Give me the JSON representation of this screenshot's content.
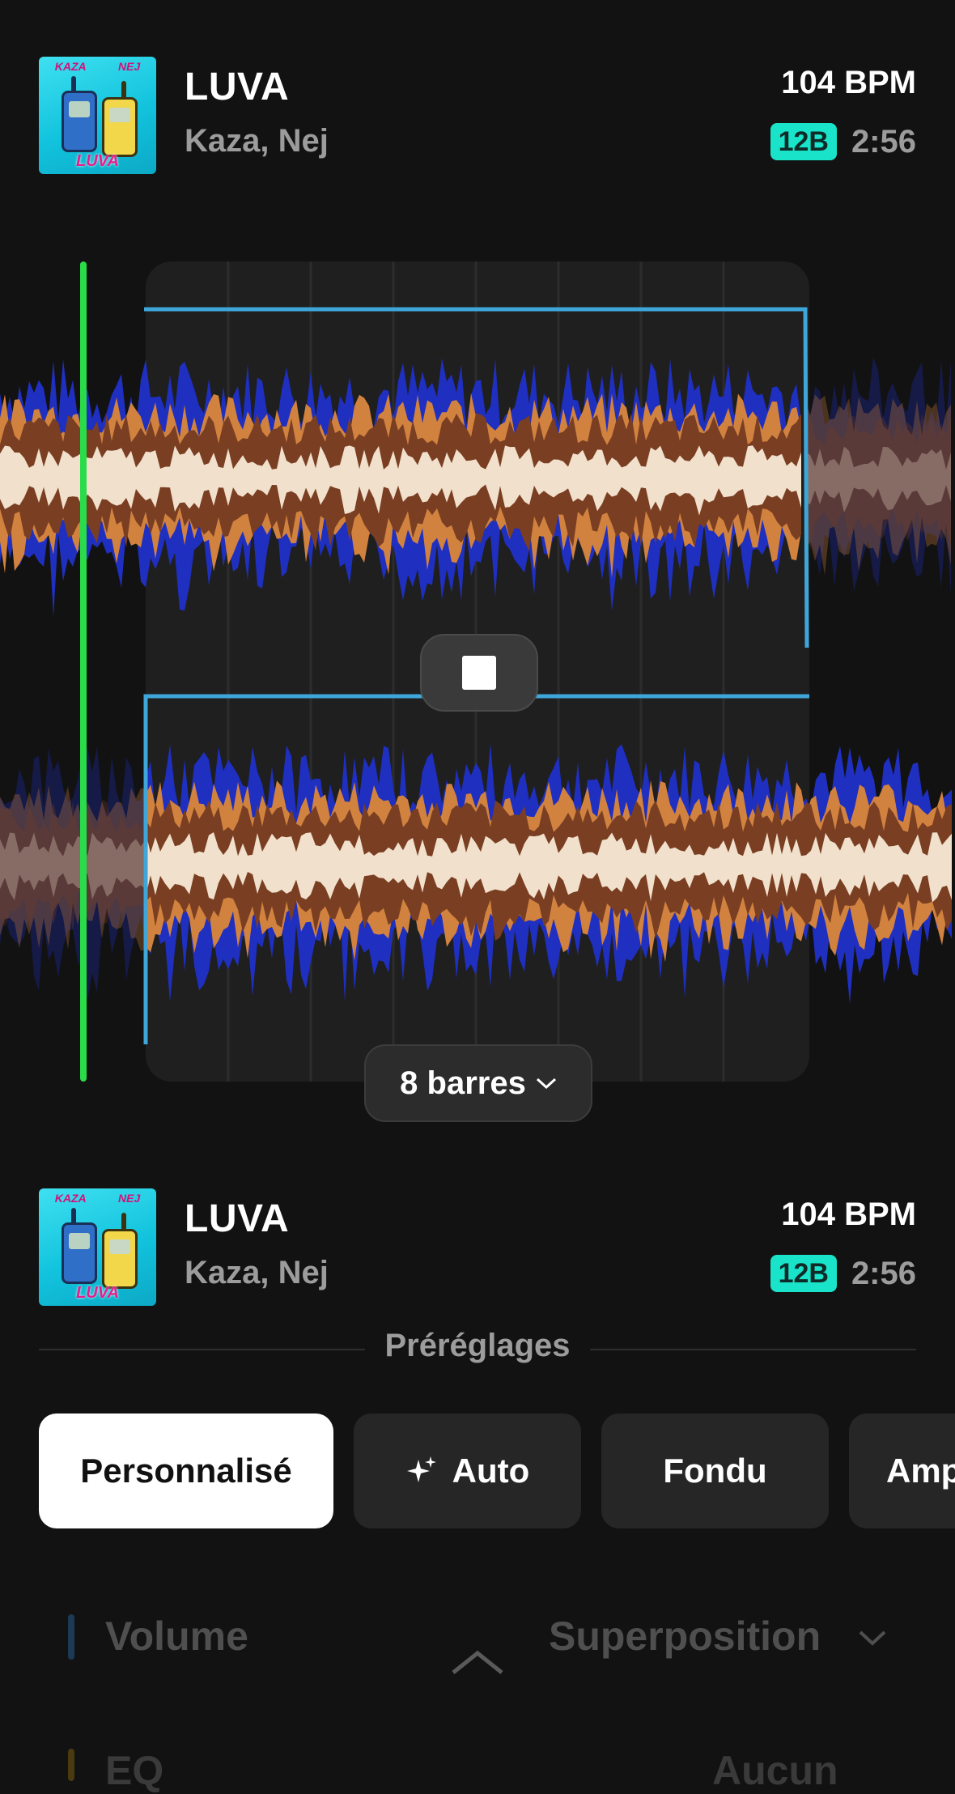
{
  "track_top": {
    "title": "LUVA",
    "artist": "Kaza, Nej",
    "bpm": "104 BPM",
    "key": "12B",
    "duration": "2:56",
    "cover": {
      "top_text_left": "KAZA",
      "top_text_right": "NEJ",
      "bottom_text": "LUVA"
    }
  },
  "track_bottom": {
    "title": "LUVA",
    "artist": "Kaza, Nej",
    "bpm": "104 BPM",
    "key": "12B",
    "duration": "2:56",
    "cover": {
      "top_text_left": "KAZA",
      "top_text_right": "NEJ",
      "bottom_text": "LUVA"
    }
  },
  "transition": {
    "length_label": "8 barres",
    "stop_icon": "stop-icon",
    "chevron_icon": "chevron-down-icon"
  },
  "presets": {
    "label": "Préréglages",
    "items": [
      {
        "label": "Personnalisé",
        "active": true
      },
      {
        "label": "Auto",
        "icon": "sparkle-icon",
        "active": false
      },
      {
        "label": "Fondu",
        "active": false
      },
      {
        "label": "Amp",
        "active": false
      }
    ]
  },
  "controls": {
    "volume_label": "Volume",
    "mode_label": "Superposition",
    "eq_label": "EQ",
    "eq_value": "Aucun",
    "collapse_icon": "chevron-up-icon"
  },
  "colors": {
    "playhead": "#2bdc4a",
    "loop_line": "#3ea6d8",
    "key_badge": "#19e3c9",
    "wave_low": "#f0e0cc",
    "wave_mid": "#7a3e22",
    "wave_mid2": "#d1823f",
    "wave_high": "#1f2fc0"
  }
}
